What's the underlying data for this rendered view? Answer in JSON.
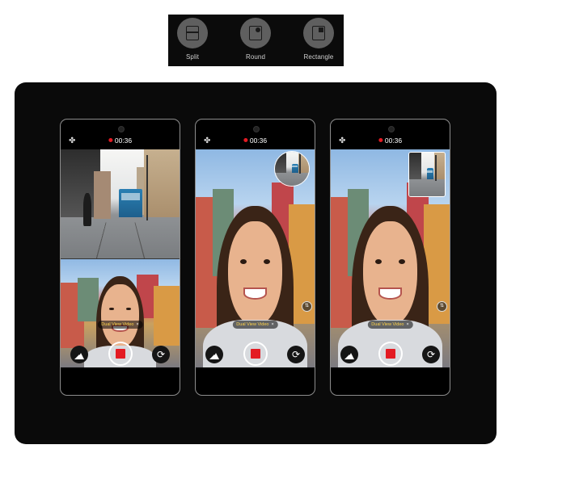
{
  "modes": [
    {
      "label": "Split",
      "icon": "split-layout-icon"
    },
    {
      "label": "Round",
      "icon": "round-pip-icon"
    },
    {
      "label": "Rectangle",
      "icon": "rectangle-pip-icon"
    }
  ],
  "phones": [
    {
      "layout": "split",
      "timer": "00:36",
      "pill": "Dual View Video",
      "pill_close": "×"
    },
    {
      "layout": "round",
      "timer": "00:36",
      "pill": "Dual View Video",
      "pill_close": "×"
    },
    {
      "layout": "rectangle",
      "timer": "00:36",
      "pill": "Dual View Video",
      "pill_close": "×"
    }
  ],
  "icons": {
    "fan": "✤",
    "flip": "⟳",
    "swap": "⇅"
  },
  "colors": {
    "record_red": "#e31b23",
    "pill_text": "#ffd34a"
  }
}
